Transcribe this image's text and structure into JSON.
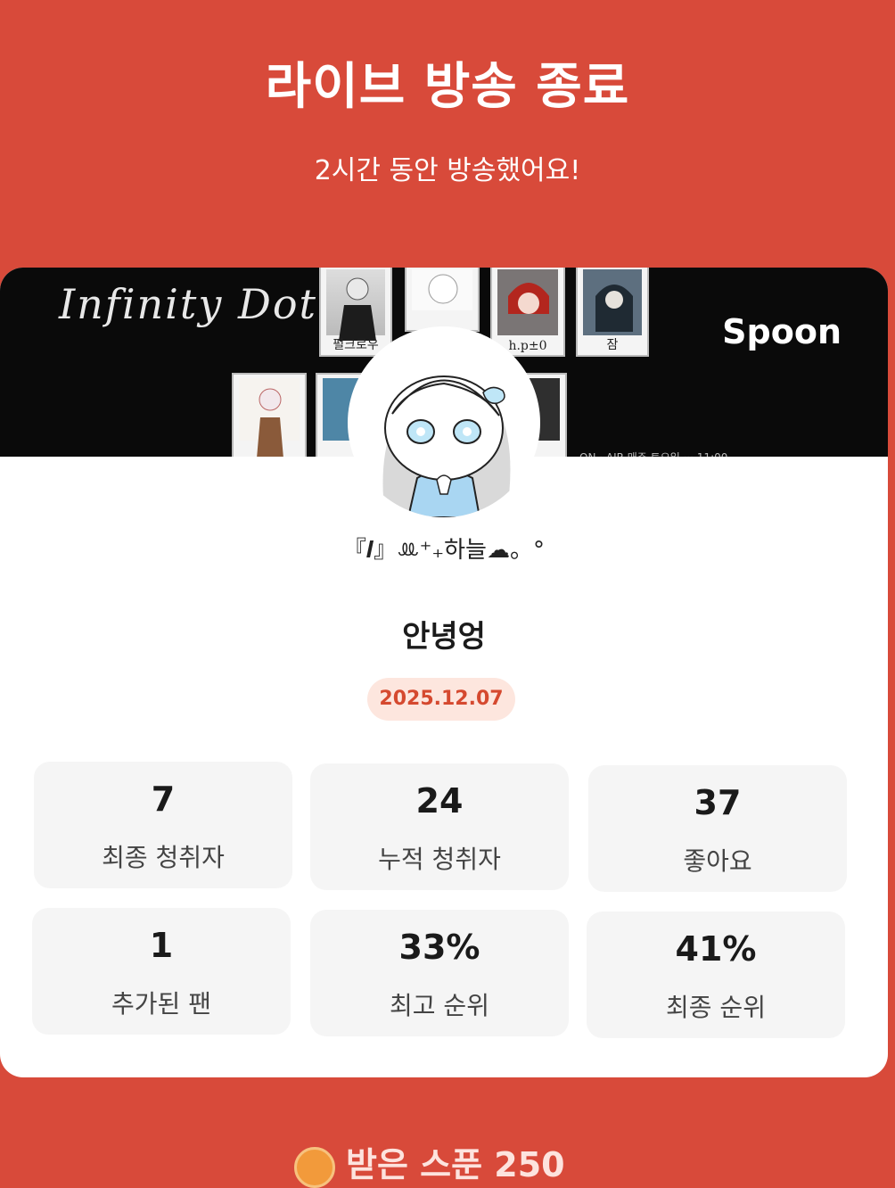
{
  "header": {
    "title": "라이브 방송 종료",
    "subtitle": "2시간 동안 방송했어요!"
  },
  "banner": {
    "title": "Infinity Dot",
    "brand": "Spoon",
    "polaroids": [
      {
        "caption": "펄크로우"
      },
      {
        "caption": ""
      },
      {
        "caption": "h.p±0"
      },
      {
        "caption": "잠"
      }
    ],
    "caption_partial": "ON · AIR 매주 토요일 ··· 11:00"
  },
  "profile": {
    "nickname": "『𝑰』ꔛ⁺₊하늘☁︎。°",
    "room_title": "안녕엉",
    "date": "2025.12.07"
  },
  "stats": [
    {
      "value": "7",
      "label": "최종 청취자"
    },
    {
      "value": "24",
      "label": "누적 청취자"
    },
    {
      "value": "37",
      "label": "좋아요"
    },
    {
      "value": "1",
      "label": "추가된 팬"
    },
    {
      "value": "33%",
      "label": "최고 순위"
    },
    {
      "value": "41%",
      "label": "최종 순위"
    }
  ],
  "footer": {
    "text_partial": "받은 스푼 250"
  },
  "colors": {
    "background": "#d84a3a",
    "card": "#ffffff",
    "accent": "#d5492f",
    "badge_bg": "#fde6de",
    "stat_bg": "#f5f5f5"
  }
}
